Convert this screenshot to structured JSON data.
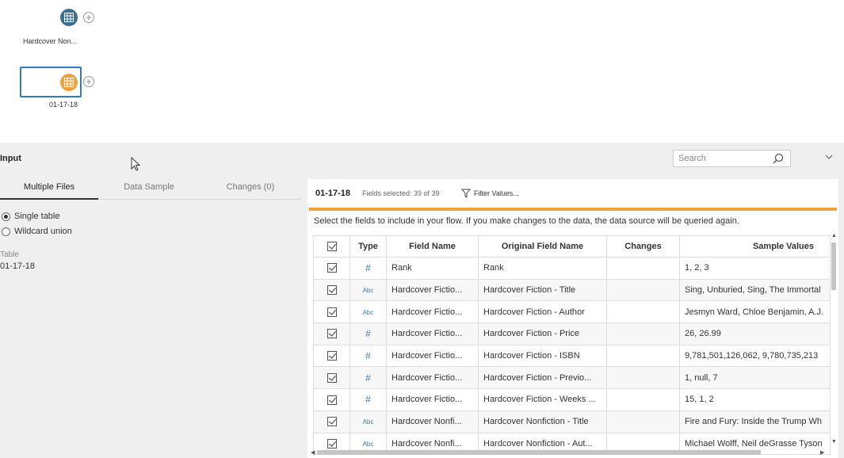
{
  "canvas": {
    "node1": {
      "label": "Hardcover Non..."
    },
    "node2": {
      "label": "01-17-18"
    }
  },
  "panel": {
    "title": "Input",
    "search_placeholder": "Search",
    "tabs": [
      {
        "label": "Multiple Files",
        "active": true
      },
      {
        "label": "Data Sample",
        "active": false
      },
      {
        "label": "Changes (0)",
        "active": false
      }
    ],
    "options": [
      {
        "label": "Single table",
        "selected": true
      },
      {
        "label": "Wildcard union",
        "selected": false
      }
    ],
    "table_label": "Table",
    "table_value": "01-17-18"
  },
  "content": {
    "name": "01-17-18",
    "fields_selected": "Fields selected: 39 of 39",
    "filter_label": "Filter Values...",
    "info": "Select the fields to include in your flow. If you make changes to the data, the data source will be queried again.",
    "accent_color": "#f0a03c",
    "columns": [
      "Type",
      "Field Name",
      "Original Field Name",
      "Changes",
      "Sample Values"
    ],
    "rows": [
      {
        "type": "#",
        "field": "Rank",
        "original": "Rank",
        "changes": "",
        "sample": "1, 2, 3"
      },
      {
        "type": "Abc",
        "field": "Hardcover Fictio...",
        "original": "Hardcover Fiction - Title",
        "changes": "",
        "sample": "Sing, Unburied, Sing, The Immortal"
      },
      {
        "type": "Abc",
        "field": "Hardcover Fictio...",
        "original": "Hardcover Fiction - Author",
        "changes": "",
        "sample": "Jesmyn Ward, Chloe Benjamin, A.J."
      },
      {
        "type": "#",
        "field": "Hardcover Fictio...",
        "original": "Hardcover Fiction - Price",
        "changes": "",
        "sample": "26, 26.99"
      },
      {
        "type": "#",
        "field": "Hardcover Fictio...",
        "original": "Hardcover Fiction - ISBN",
        "changes": "",
        "sample": "9,781,501,126,062, 9,780,735,213"
      },
      {
        "type": "#",
        "field": "Hardcover Fictio...",
        "original": "Hardcover Fiction - Previo...",
        "changes": "",
        "sample": "1, null, 7"
      },
      {
        "type": "#",
        "field": "Hardcover Fictio...",
        "original": "Hardcover Fiction - Weeks ...",
        "changes": "",
        "sample": "15, 1, 2"
      },
      {
        "type": "Abc",
        "field": "Hardcover Nonfi...",
        "original": "Hardcover Nonfiction - Title",
        "changes": "",
        "sample": "Fire and Fury: Inside the Trump Wh"
      },
      {
        "type": "Abc",
        "field": "Hardcover Nonfi...",
        "original": "Hardcover Nonfiction - Aut...",
        "changes": "",
        "sample": "Michael Wolff, Neil deGrasse Tyson"
      }
    ]
  }
}
